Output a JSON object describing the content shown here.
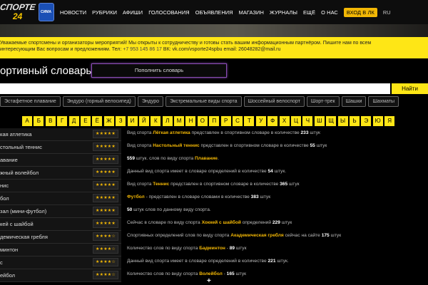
{
  "header": {
    "logo_text": "СПОРТЕ",
    "logo_sub": "24",
    "logo2_text": "СИМА",
    "nav": [
      "НОВОСТИ",
      "РУБРИКИ",
      "АФИШИ",
      "ГОЛОСОВАНИЯ",
      "ОБЪЯВЛЕНИЯ",
      "МАГАЗИН",
      "ЖУРНАЛЫ",
      "ЕЩЁ",
      "О НАС"
    ],
    "login": "ВХОД В ЛК",
    "lang": "RU"
  },
  "info": {
    "line1": "Уважаемые спортсмены и организаторы мероприятий! Мы открыты к сотрудничеству и готовы стать вашим информационным партнёром. Пишите нам по всем",
    "line2_start": "интересующим Вас вопросам и предложениям. Тел:",
    "phone": "+7 953 145 86 17",
    "vk": "ВК: vk.com/vsporte24spbu",
    "email": "email: 26048282@mail.ru"
  },
  "page": {
    "title": "ортивный словарь",
    "add_button": "Пополнить словарь"
  },
  "search": {
    "placeholder": "",
    "button": "Найти"
  },
  "tabs": [
    "Эстафетное плавание",
    "Эндуро (горный велосипед)",
    "Эндуро",
    "Экстремальные виды спорта",
    "Шоссейный велоспорт",
    "Шорт-трек",
    "Шашки",
    "Шахматы"
  ],
  "alphabet": [
    "А",
    "Б",
    "В",
    "Г",
    "Д",
    "Е",
    "Ё",
    "Ж",
    "З",
    "И",
    "Й",
    "К",
    "Л",
    "М",
    "Н",
    "О",
    "П",
    "Р",
    "С",
    "Т",
    "У",
    "Ф",
    "Х",
    "Ц",
    "Ч",
    "Ш",
    "Щ",
    "Ы",
    "Ь",
    "Э",
    "Ю",
    "Я"
  ],
  "sports": [
    {
      "name": "кая атлетика",
      "stars": "★★★★★"
    },
    {
      "name": "стольный теннис",
      "stars": "★★★★★"
    },
    {
      "name": "авание",
      "stars": "★★★★★"
    },
    {
      "name": "жный волейбол",
      "stars": "★★★★★"
    },
    {
      "name": "нис",
      "stars": "★★★★★"
    },
    {
      "name": "бол",
      "stars": "★★★★★"
    },
    {
      "name": "зал (мини-футбол)",
      "stars": "★★★★★"
    },
    {
      "name": "кей с шайбой",
      "stars": "★★★★★"
    },
    {
      "name": "демическая гребля",
      "stars": "★★★★☆"
    },
    {
      "name": "минтон",
      "stars": "★★★★☆"
    },
    {
      "name": "с",
      "stars": "★★★★☆"
    },
    {
      "name": "ейбол",
      "stars": "★★★★☆"
    }
  ],
  "descriptions": [
    {
      "pre": "Вид спорта ",
      "hl": "Лёгкая атлетика",
      "mid": " представлен в спортивном словаре в количестве ",
      "num": "233",
      "post": " штук"
    },
    {
      "pre": "Вид спорта ",
      "hl": "Настольный теннис",
      "mid": " представлен в спортивном словаре в количестве ",
      "num": "55",
      "post": " штук"
    },
    {
      "pre": "",
      "num_first": "559",
      "mid": " штук. слов по виду спорта ",
      "hl": "Плавание",
      "post": "."
    },
    {
      "pre": "Данный вид спорта имеет в словаре определений в количестве ",
      "num": "54",
      "post": " штук."
    },
    {
      "pre": "Вид спорта ",
      "hl": "Теннис",
      "mid": " представлен в спортивном словаре в количестве ",
      "num": "365",
      "post": " штук"
    },
    {
      "pre": "",
      "hl": "Футбол",
      "mid": " - представлен в словаре словами в количестве ",
      "num": "383",
      "post": " штук"
    },
    {
      "pre": "",
      "num_first": "50",
      "mid": " штук слов по данному виду спорта.",
      "post": ""
    },
    {
      "pre": "Сейчас в словаре по виду спорта ",
      "hl": "Хоккей с шайбой",
      "mid": " определений ",
      "num": "229",
      "post": " штук"
    },
    {
      "pre": "Спортивных определений слов по виду спорта ",
      "hl": "Академическая гребля",
      "mid": " сейчас на сайте ",
      "num": "175",
      "post": " штук"
    },
    {
      "pre": "Количество слов по виду спорта ",
      "hl": "Бадминтон",
      "mid": " - ",
      "num": "89",
      "post": " штук"
    },
    {
      "pre": "Данный вид спорта имеет в словаре определений в количестве ",
      "num": "221",
      "post": " штук."
    },
    {
      "pre": "Количество слов по виду спорта ",
      "hl": "Волейбол",
      "mid": " - ",
      "num": "165",
      "post": " штук"
    }
  ],
  "plus_sign": "+"
}
